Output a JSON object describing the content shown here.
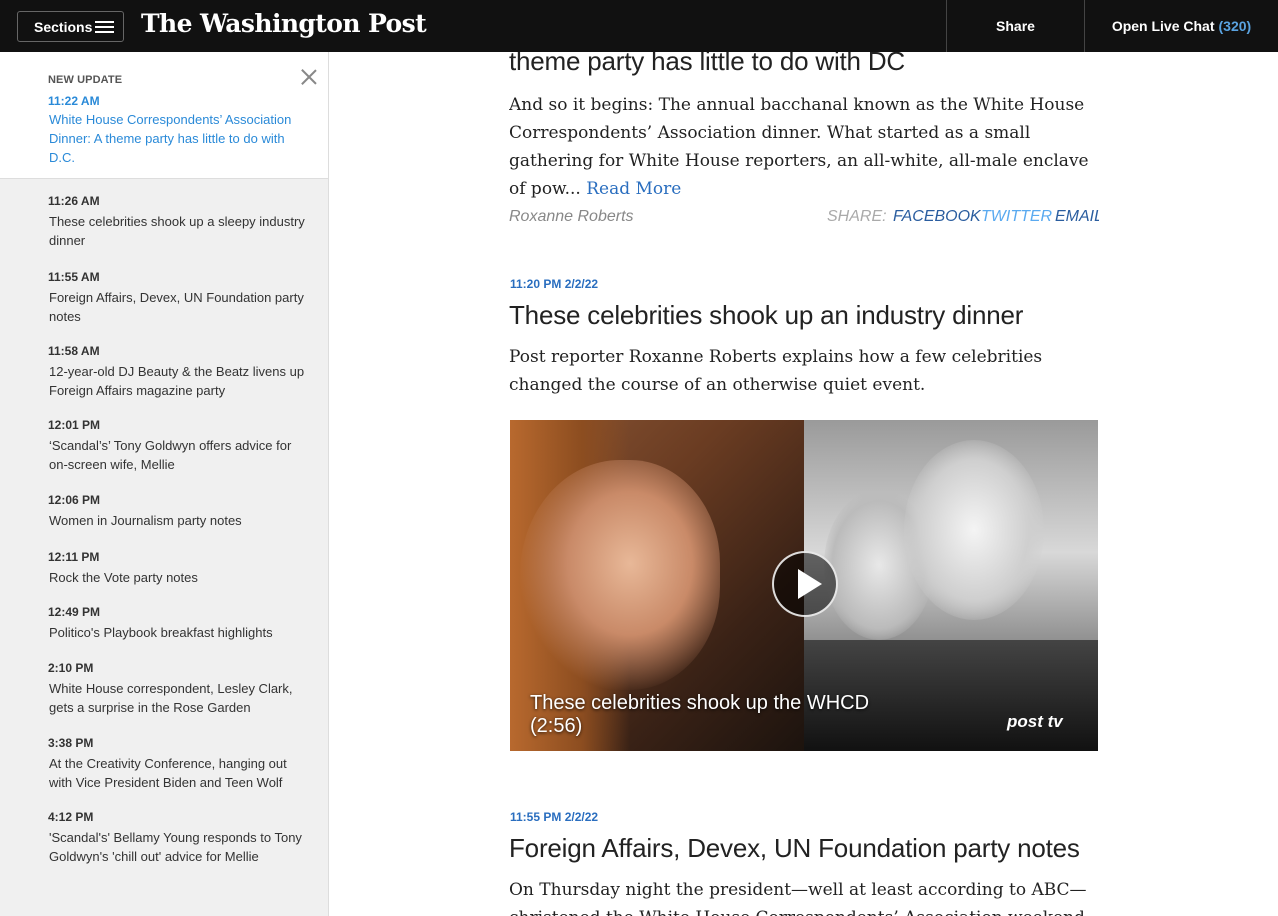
{
  "header": {
    "sections_label": "Sections",
    "logo_text": "The Washington Post",
    "share_label": "Share",
    "chat_label": "Open Live Chat",
    "chat_count": "(320)"
  },
  "sidebar": {
    "new_update": {
      "label": "NEW UPDATE",
      "time": "11:22 AM",
      "text": "White House Correspondents’ Association Dinner: A theme party has little to do with D.C."
    },
    "items": [
      {
        "time": "11:26 AM",
        "text": "These celebrities shook up a sleepy industry dinner"
      },
      {
        "time": "11:55 AM",
        "text": "Foreign Affairs, Devex, UN Foundation party notes"
      },
      {
        "time": "11:58 AM",
        "text": "12-year-old DJ Beauty & the Beatz livens up Foreign Affairs magazine party"
      },
      {
        "time": "12:01 PM",
        "text": "‘Scandal’s’ Tony Goldwyn offers advice for on-screen wife, Mellie"
      },
      {
        "time": "12:06 PM",
        "text": "Women in Journalism party notes"
      },
      {
        "time": "12:11 PM",
        "text": "Rock the Vote party notes"
      },
      {
        "time": "12:49 PM",
        "text": "Politico's Playbook breakfast highlights"
      },
      {
        "time": "2:10 PM",
        "text": "White House correspondent, Lesley Clark, gets a surprise in the Rose Garden"
      },
      {
        "time": "3:38 PM",
        "text": "At the Creativity Conference, hanging out with Vice President Biden and Teen Wolf"
      },
      {
        "time": "4:12 PM",
        "text": "'Scandal's' Bellamy Young responds to Tony Goldwyn's 'chill out' advice for Mellie"
      }
    ]
  },
  "posts": [
    {
      "headline": "theme party has little to do with DC",
      "body": "And so it begins: The annual bacchanal known as the White House Correspondents’ Association dinner. What started as a small gathering for White House reporters, an all-white, all-male enclave of pow...",
      "read_more": "Read More",
      "author": "Roxanne Roberts",
      "share_label": "SHARE:",
      "facebook": "FACEBOOK",
      "twitter": "TWITTER",
      "email": "EMAIL"
    },
    {
      "timestamp": "11:20 PM 2/2/22",
      "headline": "These celebrities shook up an industry dinner",
      "body": "Post reporter Roxanne Roberts explains how a few celebrities changed the course of an otherwise quiet event.",
      "video": {
        "title": "These celebrities shook up the WHCD",
        "duration": "(2:56)",
        "brand": "post tv"
      }
    },
    {
      "timestamp": "11:55 PM 2/2/22",
      "headline": "Foreign Affairs, Devex, UN Foundation party notes",
      "body": "On Thursday night the president—well at least according to ABC— christened the White House Correspondents’ Association weekend at"
    }
  ]
}
